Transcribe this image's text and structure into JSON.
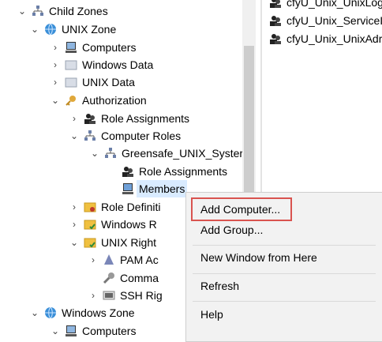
{
  "tree": {
    "child_zones": "Child Zones",
    "unix_zone": "UNIX Zone",
    "computers": "Computers",
    "windows_data": "Windows Data",
    "unix_data": "UNIX Data",
    "authorization": "Authorization",
    "role_assignments": "Role Assignments",
    "computer_roles": "Computer Roles",
    "greensafe": "Greensafe_UNIX_Syster",
    "gs_role_assignments": "Role Assignments",
    "members": "Members",
    "role_definitions": "Role Definiti",
    "windows_rights": "Windows R",
    "unix_rights": "UNIX Right",
    "pam_access": "PAM Ac",
    "commands": "Comma",
    "ssh_rights": "SSH Rig",
    "windows_zone": "Windows Zone",
    "wz_computers": "Computers"
  },
  "right_pane": {
    "items": [
      "cfyU_Unix_UnixLog",
      "cfyU_Unix_ServiceI",
      "cfyU_Unix_UnixAdr"
    ]
  },
  "context_menu": {
    "add_computer": "Add Computer...",
    "add_group": "Add Group...",
    "new_window": "New Window from Here",
    "refresh": "Refresh",
    "help": "Help"
  },
  "colors": {
    "highlight_border": "#d9534f",
    "selection": "#d9ebff"
  }
}
